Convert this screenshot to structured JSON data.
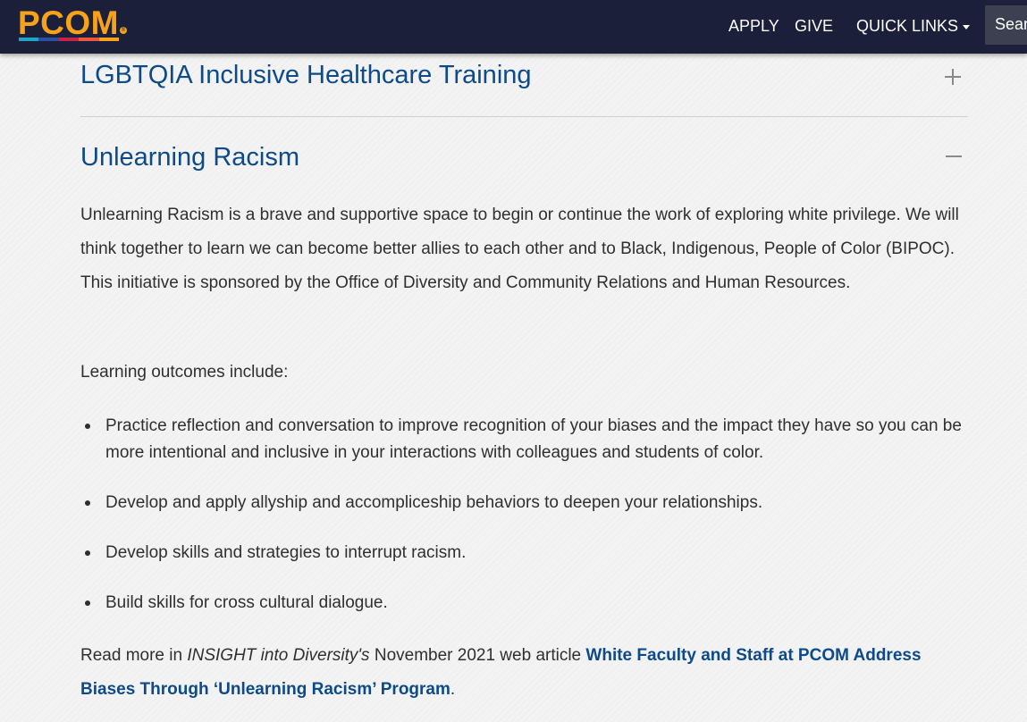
{
  "header": {
    "logo_text": "PCOM",
    "logo_stripes": [
      "#1aa6c4",
      "#2d4fa0",
      "#c8224c",
      "#e9573f",
      "#f6a21a"
    ],
    "nav": {
      "apply": "APPLY",
      "give": "GIVE",
      "quick_links": "QUICK LINKS"
    },
    "search_placeholder": "Search"
  },
  "accordion": {
    "item1": {
      "title": "LGBTQIA Inclusive Healthcare Training",
      "state_icon": "plus-icon"
    },
    "item2": {
      "title": "Unlearning Racism",
      "state_icon": "minus-icon",
      "intro": "Unlearning Racism is a brave and supportive space to begin or continue the work of exploring white privilege. We will think together to learn we can become better allies to each other and to Black, Indigenous, People of Color (BIPOC). This initiative is sponsored by the Office of Diversity and Community Relations and Human Resources.",
      "outcomes_heading": "Learning outcomes include:",
      "outcomes": [
        "Practice reflection and conversation to improve recognition of your biases and the impact they have so you can be more intentional and inclusive in your interactions with colleagues and students of color.",
        "Develop and apply allyship and accompliceship behaviors to deepen your relationships.",
        "Develop skills and strategies to interrupt racism.",
        "Build skills for cross cultural dialogue."
      ],
      "read_more": {
        "prefix": "Read more in ",
        "publication": "INSIGHT into Diversity's",
        "middle": " November 2021 web article ",
        "link_text": "White Faculty and Staff at PCOM Address Biases Through ‘Unlearning Racism’ Program",
        "suffix": "."
      }
    }
  },
  "colors": {
    "navbar": "#1b1f3a",
    "brand_orange": "#f6a21a",
    "link_blue": "#0d4a8a"
  }
}
